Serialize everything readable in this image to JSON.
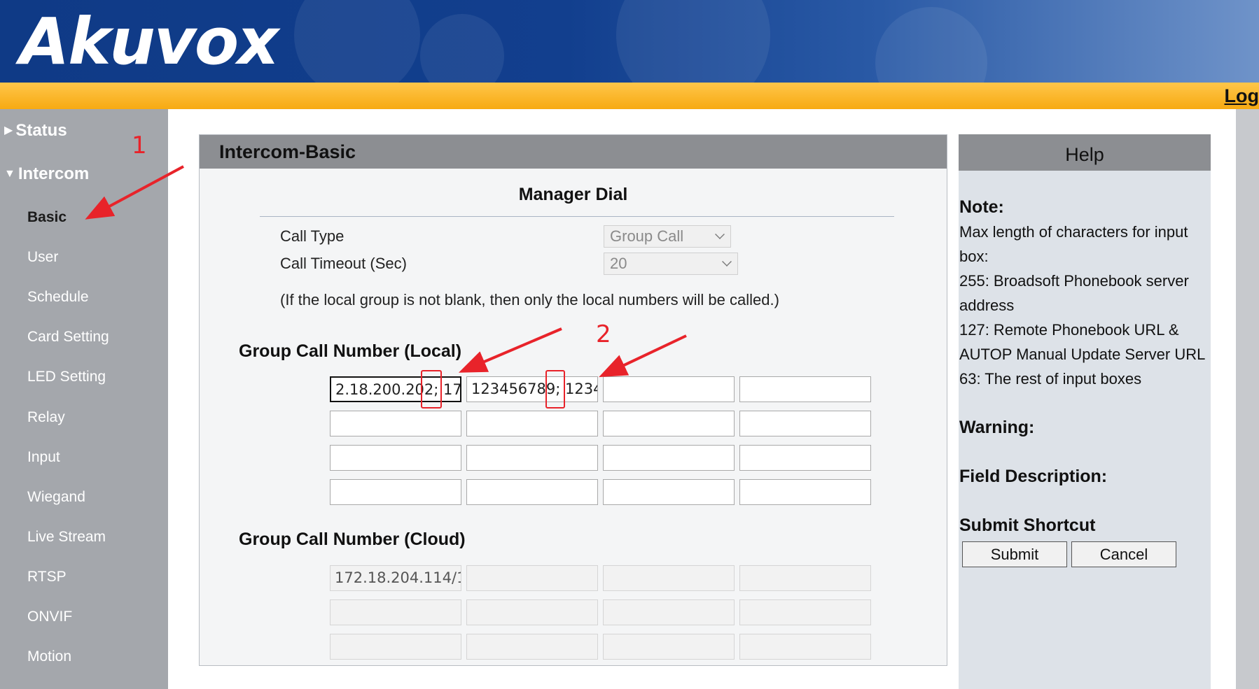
{
  "header": {
    "logo_text": "Akuvox",
    "logout_label": "Log"
  },
  "sidebar": {
    "groups": [
      {
        "label": "Status",
        "expanded": false
      },
      {
        "label": "Intercom",
        "expanded": true
      }
    ],
    "items": [
      "Basic",
      "User",
      "Schedule",
      "Card Setting",
      "LED Setting",
      "Relay",
      "Input",
      "Wiegand",
      "Live Stream",
      "RTSP",
      "ONVIF",
      "Motion"
    ],
    "active_item": "Basic"
  },
  "panel": {
    "title": "Intercom-Basic",
    "section_title": "Manager Dial",
    "call_type": {
      "label": "Call Type",
      "value": "Group Call"
    },
    "call_timeout": {
      "label": "Call Timeout (Sec)",
      "value": "20"
    },
    "note": "(If the local group is not blank, then only the local numbers will be called.)",
    "local_group": {
      "heading": "Group Call Number (Local)",
      "fields": [
        "2.18.200.202; 17",
        "123456789; 1234",
        "",
        "",
        "",
        "",
        "",
        "",
        "",
        "",
        "",
        "",
        "",
        "",
        "",
        ""
      ]
    },
    "cloud_group": {
      "heading": "Group Call Number (Cloud)",
      "fields": [
        "172.18.204.114/1",
        "",
        "",
        "",
        "",
        "",
        "",
        "",
        "",
        "",
        "",
        ""
      ]
    }
  },
  "help": {
    "title": "Help",
    "note_heading": "Note:",
    "note_lines": [
      "Max length of characters for input",
      "box:",
      "255: Broadsoft Phonebook server",
      "address",
      "127: Remote Phonebook URL &",
      "AUTOP Manual Update Server URL",
      "63: The rest of input boxes"
    ],
    "warning_heading": "Warning:",
    "field_desc_heading": "Field Description:",
    "submit_shortcut_heading": "Submit Shortcut",
    "submit_label": "Submit",
    "cancel_label": "Cancel"
  },
  "annotations": {
    "step1": "1",
    "step2": "2",
    "accent_color": "#e8232a"
  }
}
